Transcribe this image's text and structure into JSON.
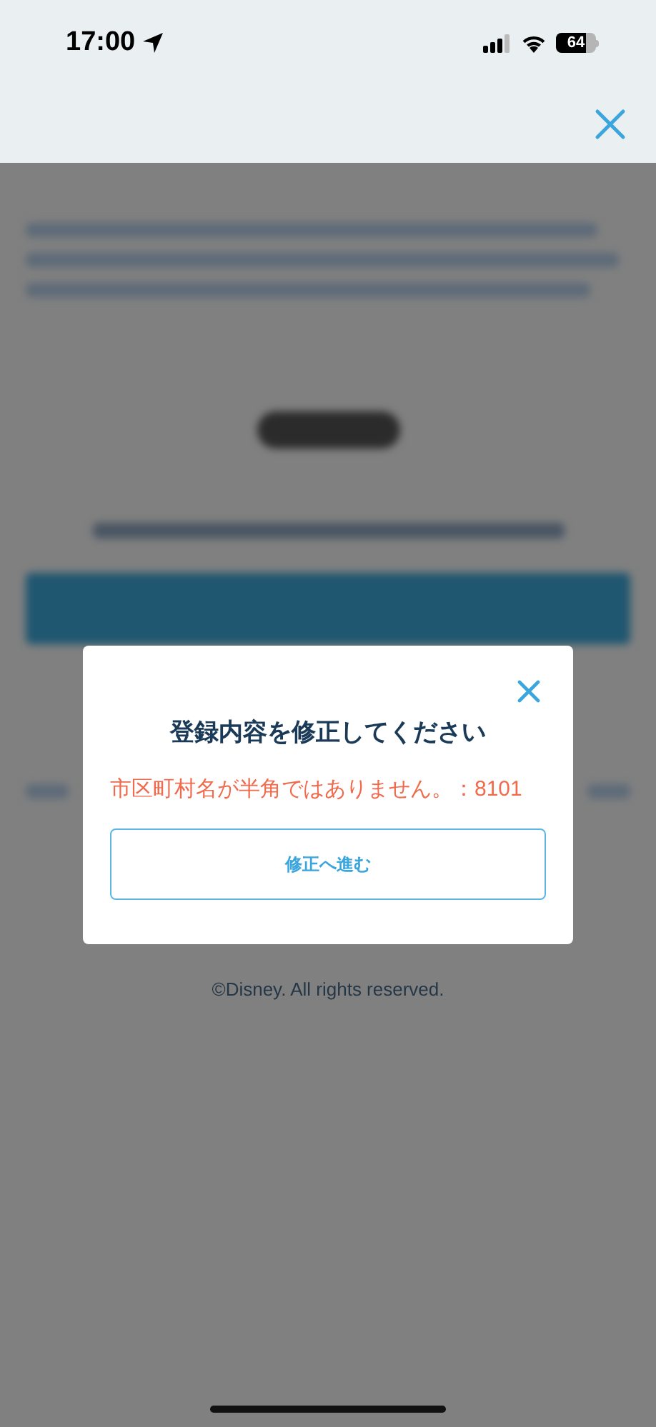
{
  "status_bar": {
    "time": "17:00",
    "battery": "64"
  },
  "dialog": {
    "title": "登録内容を修正してください",
    "message": "市区町村名が半角ではありません。：8101",
    "button": "修正へ進む"
  },
  "footer": {
    "copyright": "©Disney. All rights reserved."
  }
}
